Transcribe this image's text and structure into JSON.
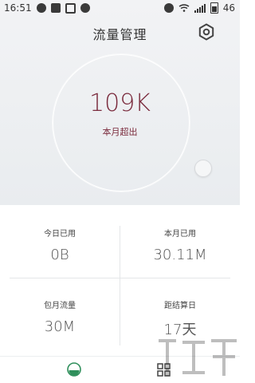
{
  "status_bar": {
    "time": "16:51",
    "battery": "46",
    "left_icons": [
      "sync-icon",
      "image-icon",
      "photo-icon",
      "info-icon"
    ],
    "right_icons": [
      "alarm-icon",
      "wifi-icon",
      "signal-icon",
      "battery-icon"
    ]
  },
  "header": {
    "title": "流量管理",
    "settings_icon": "gear-icon"
  },
  "usage": {
    "value": "109K",
    "label": "本月超出",
    "accent_color": "#7a2a3c"
  },
  "stats": [
    {
      "label": "今日已用",
      "value": "0B"
    },
    {
      "label": "本月已用",
      "value": "30.11M"
    },
    {
      "label": "包月流量",
      "value": "30M"
    },
    {
      "label": "距结算日",
      "value": "17天"
    }
  ],
  "bottom_nav": {
    "items": [
      "traffic-tab-icon",
      "grid-menu-icon"
    ]
  }
}
